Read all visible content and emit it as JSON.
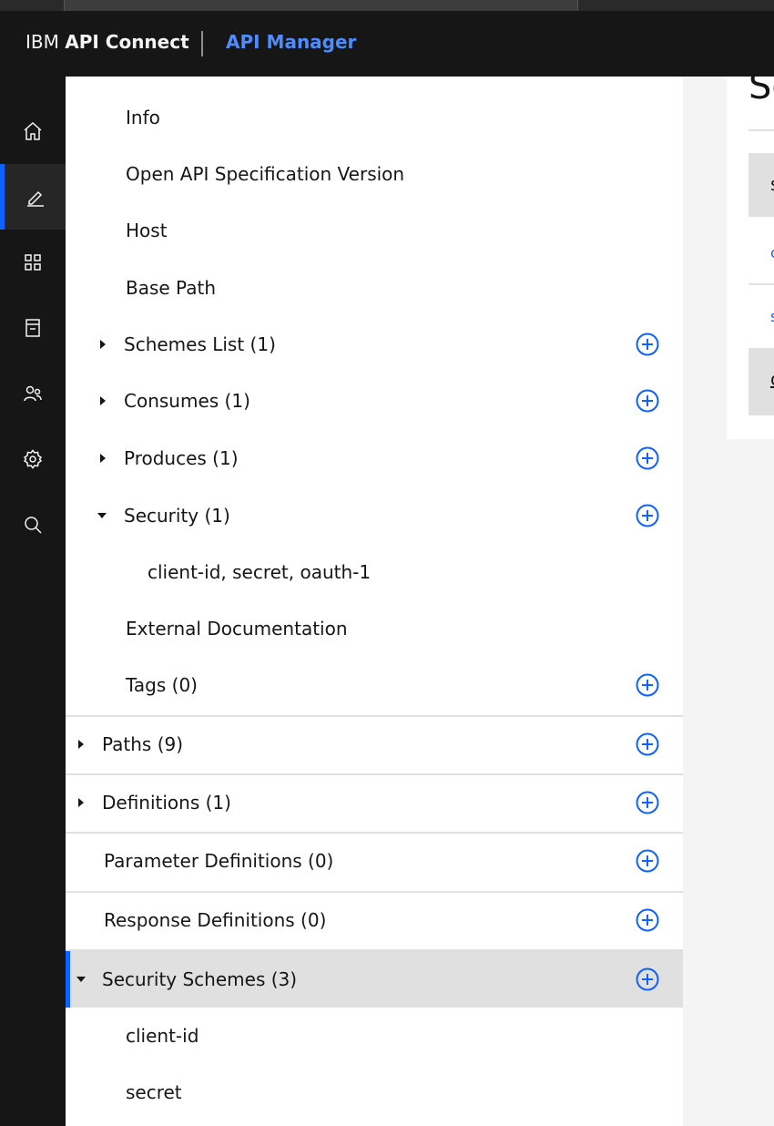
{
  "header": {
    "brand_ibm": "IBM",
    "brand_product": "API Connect",
    "app_name": "API Manager"
  },
  "leftnav": {
    "icons": [
      "home-icon",
      "edit-icon",
      "apps-icon",
      "catalog-icon",
      "users-icon",
      "settings-icon",
      "search-icon"
    ],
    "active": "edit-icon"
  },
  "tree": {
    "info": "Info",
    "openapi_version": "Open API Specification Version",
    "host": "Host",
    "base_path": "Base Path",
    "schemes_list": "Schemes List (1)",
    "consumes": "Consumes (1)",
    "produces": "Produces (1)",
    "security": "Security (1)",
    "security_child": "client-id, secret, oauth-1",
    "external_docs": "External Documentation",
    "tags": "Tags (0)",
    "paths": "Paths (9)",
    "definitions": "Definitions (1)",
    "parameter_definitions": "Parameter Definitions (0)",
    "response_definitions": "Response Definitions (0)",
    "security_schemes": "Security Schemes (3)",
    "scheme_client_id": "client-id",
    "scheme_secret": "secret"
  },
  "right_card": {
    "title_partial": "Se",
    "header_partial": "s",
    "link1_partial": "c",
    "link2_partial": "s",
    "footer_partial": "c"
  },
  "colors": {
    "accent": "#0f62fe",
    "app_name": "#4c8cff",
    "topbar": "#161616",
    "selected_row": "#e0e0e0"
  }
}
